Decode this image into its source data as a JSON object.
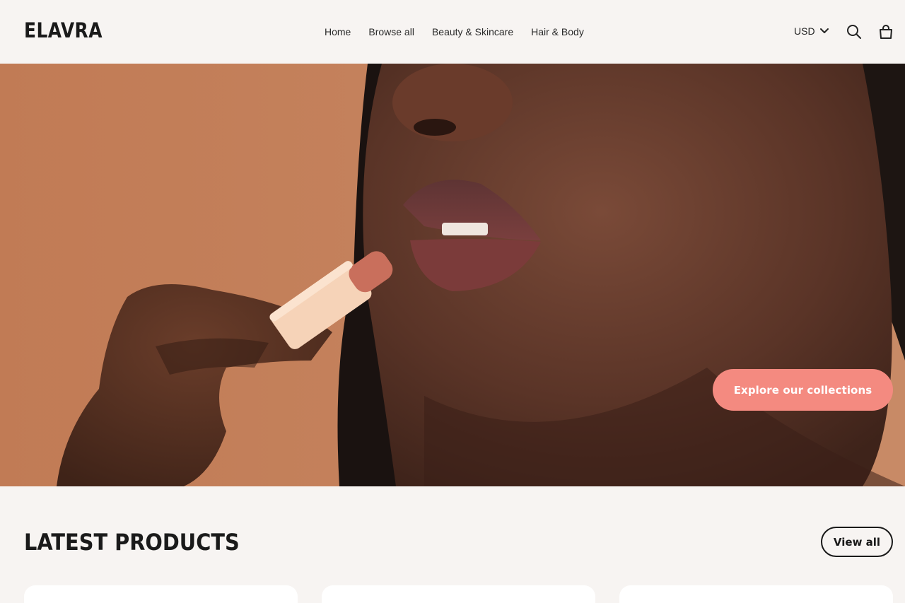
{
  "header": {
    "logo": "ELAVRA",
    "nav": [
      "Home",
      "Browse all",
      "Beauty & Skincare",
      "Hair & Body"
    ],
    "currency": "USD",
    "icons": [
      "chevron-down-icon",
      "search-icon",
      "shopping-bag-icon"
    ]
  },
  "hero": {
    "cta_label": "Explore our collections",
    "image": "close-up of a woman applying a peach lipstick to her lips",
    "accent_color": "#f48a80"
  },
  "latest": {
    "title": "LATEST PRODUCTS",
    "view_all_label": "View all"
  },
  "colors": {
    "page_bg": "#f7f4f2",
    "hero_bg": "#c07f5a",
    "cta": "#f48a80",
    "text": "#1a1a1a"
  }
}
